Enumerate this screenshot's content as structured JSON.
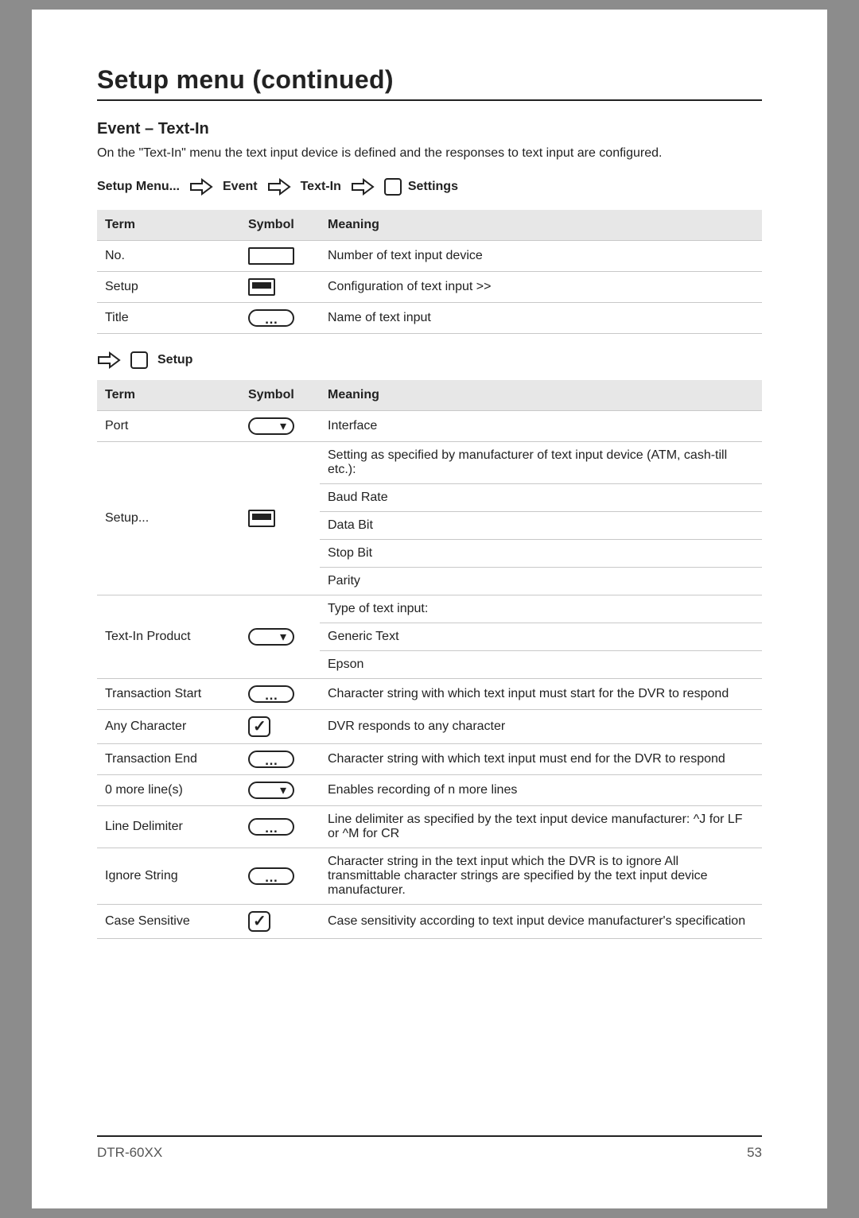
{
  "title": "Setup menu (continued)",
  "section_title": "Event – Text-In",
  "intro": "On the \"Text-In\" menu the text input device is defined and the responses to text input are configured.",
  "breadcrumb": {
    "item0": "Setup Menu...",
    "item1": "Event",
    "item2": "Text-In",
    "item3": "Settings"
  },
  "table_headers": {
    "term": "Term",
    "symbol": "Symbol",
    "meaning": "Meaning"
  },
  "table1": {
    "rows": [
      {
        "term": "No.",
        "symbol": "textfield",
        "meaning": "Number of text input device"
      },
      {
        "term": "Setup",
        "symbol": "fill",
        "meaning": "Configuration of text input >>"
      },
      {
        "term": "Title",
        "symbol": "ellipsis",
        "meaning": "Name of text input"
      }
    ]
  },
  "sub_breadcrumb_label": "Setup",
  "table2": {
    "rows": [
      {
        "term": "Port",
        "symbol": "dropdown",
        "meaning": "Interface"
      },
      {
        "term": "Setup...",
        "symbol": "fill",
        "meaning_multi": [
          "Setting as specified by manufacturer of text input device (ATM, cash-till etc.):",
          "Baud Rate",
          "Data Bit",
          "Stop Bit",
          "Parity"
        ]
      },
      {
        "term": "Text-In Product",
        "symbol": "dropdown",
        "meaning_multi": [
          "Type of text input:",
          "Generic Text",
          "Epson"
        ]
      },
      {
        "term": "Transaction Start",
        "symbol": "ellipsis",
        "meaning": "Character string with which text input must start for the DVR to respond"
      },
      {
        "term": "Any Character",
        "symbol": "check",
        "meaning": "DVR responds to any character"
      },
      {
        "term": "Transaction End",
        "symbol": "ellipsis",
        "meaning": "Character string with which text input must end for the DVR to respond"
      },
      {
        "term": "0 more line(s)",
        "symbol": "dropdown",
        "meaning": "Enables recording of n more lines"
      },
      {
        "term": "Line Delimiter",
        "symbol": "ellipsis",
        "meaning": "Line delimiter as specified by the text input device manufacturer: ^J for LF or ^M for CR"
      },
      {
        "term": "Ignore String",
        "symbol": "ellipsis",
        "meaning": "Character string in the text input which the DVR is to ignore All transmittable character strings are specified by the text input device manufacturer."
      },
      {
        "term": "Case Sensitive",
        "symbol": "check",
        "meaning": "Case sensitivity according to text input device manufacturer's specification"
      }
    ]
  },
  "footer": {
    "model": "DTR-60XX",
    "page": "53"
  }
}
